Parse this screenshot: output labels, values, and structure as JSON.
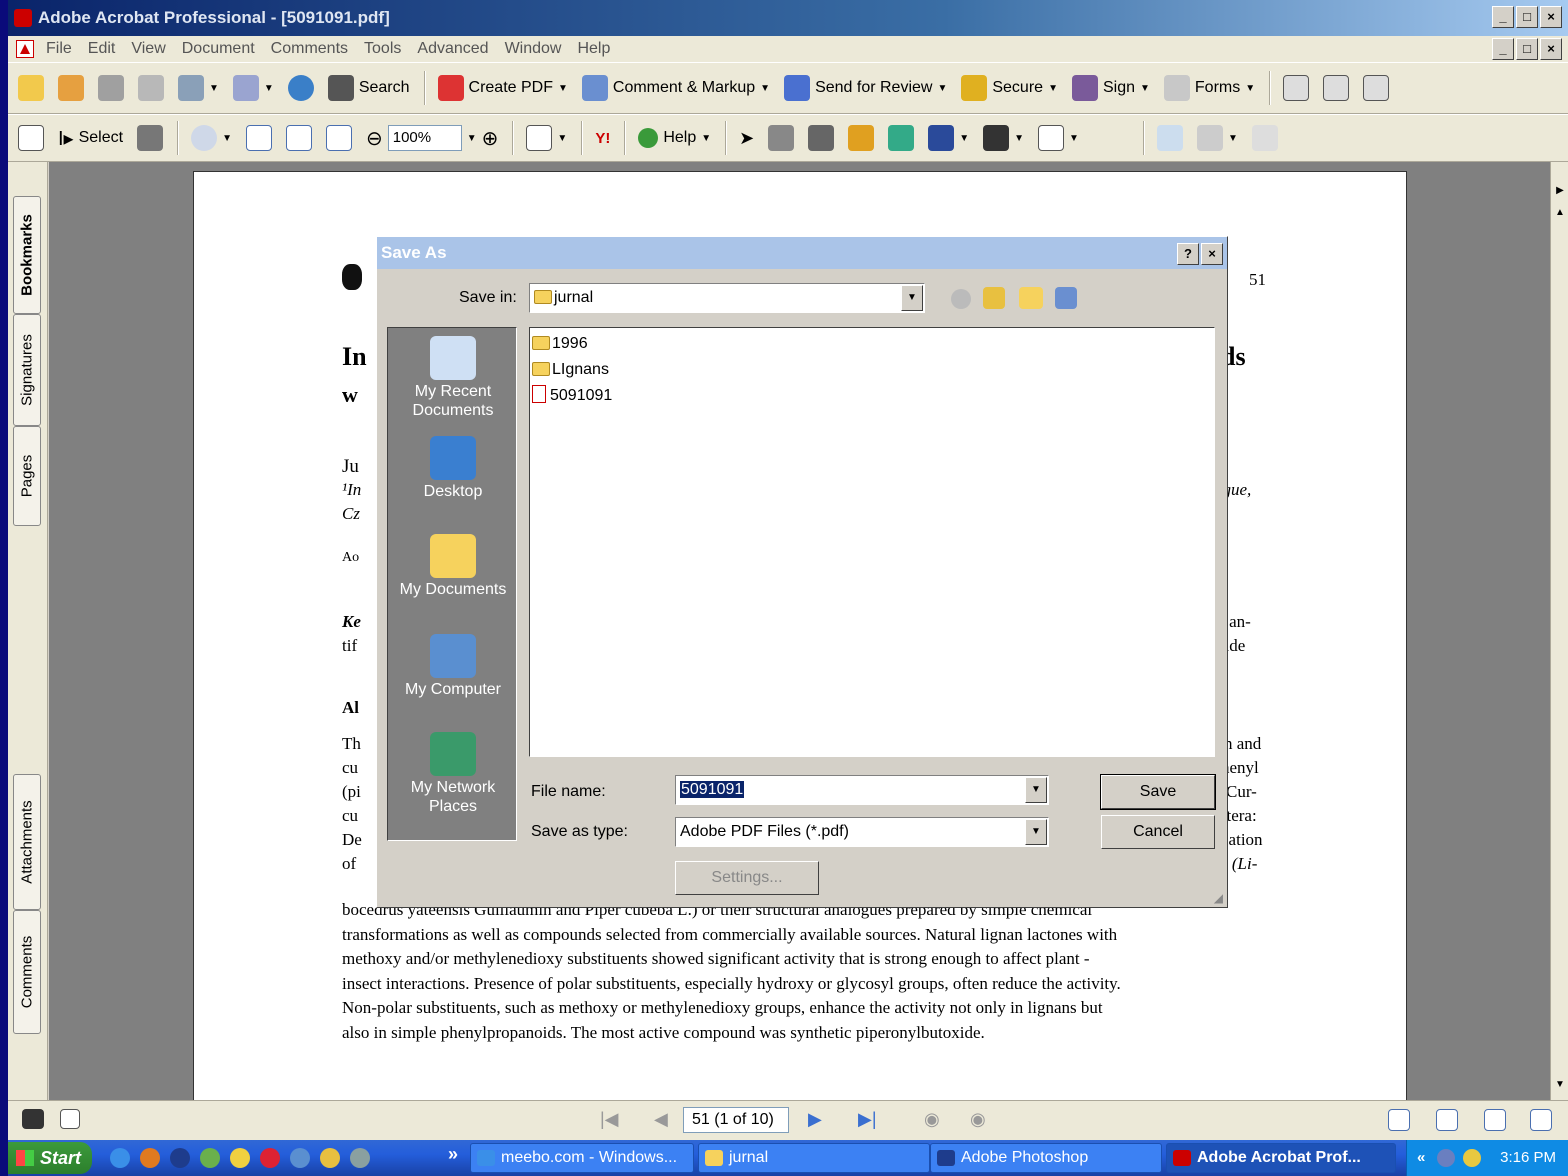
{
  "window": {
    "title": "Adobe Acrobat Professional - [5091091.pdf]",
    "controls": [
      "_",
      "□",
      "×"
    ]
  },
  "menu": [
    "File",
    "Edit",
    "View",
    "Document",
    "Comments",
    "Tools",
    "Advanced",
    "Window",
    "Help"
  ],
  "toolbar1": {
    "search": "Search",
    "create_pdf": "Create PDF",
    "comment_markup": "Comment & Markup",
    "send_for_review": "Send for Review",
    "secure": "Secure",
    "sign": "Sign",
    "forms": "Forms"
  },
  "toolbar2": {
    "select": "Select",
    "zoom": "100%",
    "help": "Help",
    "yahoo": "Y!"
  },
  "nav_tabs": [
    "Bookmarks",
    "Signatures",
    "Pages",
    "Attachments",
    "Comments"
  ],
  "document": {
    "page_number": "51",
    "left_fragments": [
      "In",
      "w",
      "Ju",
      "¹In",
      "Cz",
      "Ao",
      "Ke",
      "tif",
      "Al",
      "Th",
      "cu",
      "(pi",
      "cu",
      "De",
      "of"
    ],
    "right_fragments": [
      "ds",
      "ague,",
      "s, an-",
      "xide",
      "n and",
      "henyl",
      "Cur-",
      "ptera:",
      "cation",
      "s (Li-"
    ],
    "abstract_lines": [
      "bocedrus yateensis Guillaumin and Piper cubeba L.) or their structural analogues prepared by simple chemical",
      "transformations as well as compounds selected from commercially available sources. Natural lignan lactones with",
      "methoxy and/or methylenedioxy substituents showed significant activity that is strong enough to affect plant -",
      "insect interactions. Presence of polar substituents, especially hydroxy or glycosyl groups, often reduce the activity.",
      "Non-polar substituents, such as methoxy or methylenedioxy groups, enhance the activity not only in lignans but",
      "also in simple phenylpropanoids. The most active compound was synthetic piperonylbutoxide."
    ]
  },
  "status": {
    "page_nav": "51 (1 of 10)"
  },
  "dialog": {
    "title": "Save As",
    "save_in_label": "Save in:",
    "save_in_value": "jurnal",
    "places": [
      "My Recent\nDocuments",
      "Desktop",
      "My Documents",
      "My Computer",
      "My Network\nPlaces"
    ],
    "files": [
      {
        "name": "1996",
        "type": "folder"
      },
      {
        "name": "LIgnans",
        "type": "folder"
      },
      {
        "name": "5091091",
        "type": "pdf"
      }
    ],
    "file_name_label": "File name:",
    "file_name_value": "5091091",
    "save_type_label": "Save as type:",
    "save_type_value": "Adobe PDF Files (*.pdf)",
    "save_button": "Save",
    "cancel_button": "Cancel",
    "settings_button": "Settings...",
    "help_button": "?"
  },
  "taskbar": {
    "start": "Start",
    "tasks": [
      "meebo.com - Windows...",
      "jurnal",
      "Adobe Photoshop",
      "Adobe Acrobat Prof..."
    ],
    "clock": "3:16 PM",
    "overflow": "»",
    "tray_overflow": "«"
  },
  "colors": {
    "slide_border": "#0a0a7a",
    "titlebar": "#0a246a",
    "dialog_title": "#aac4e8",
    "taskbar": "#245edb"
  }
}
